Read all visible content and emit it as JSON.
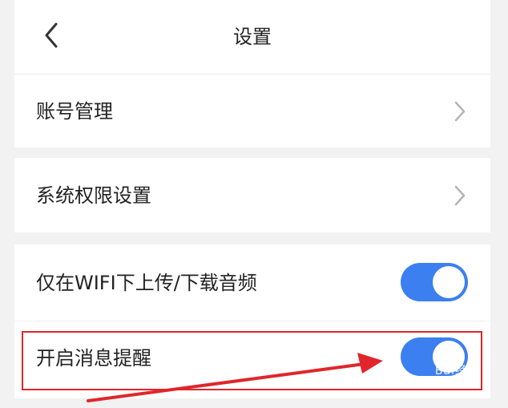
{
  "header": {
    "title": "设置",
    "back_icon": "chevron-left-icon"
  },
  "rows": [
    {
      "label": "账号管理",
      "type": "link"
    },
    {
      "label": "系统权限设置",
      "type": "link"
    },
    {
      "label": "仅在WIFI下上传/下载音频",
      "type": "toggle",
      "enabled": true
    },
    {
      "label": "开启消息提醒",
      "type": "toggle",
      "enabled": true
    }
  ],
  "annotation": {
    "highlight_color": "#e0262b"
  },
  "watermark": {
    "text": "Bai经验",
    "sub": "jingyan.baidu.com"
  },
  "colors": {
    "accent": "#3c7ff0",
    "background": "#f2f2f2"
  }
}
